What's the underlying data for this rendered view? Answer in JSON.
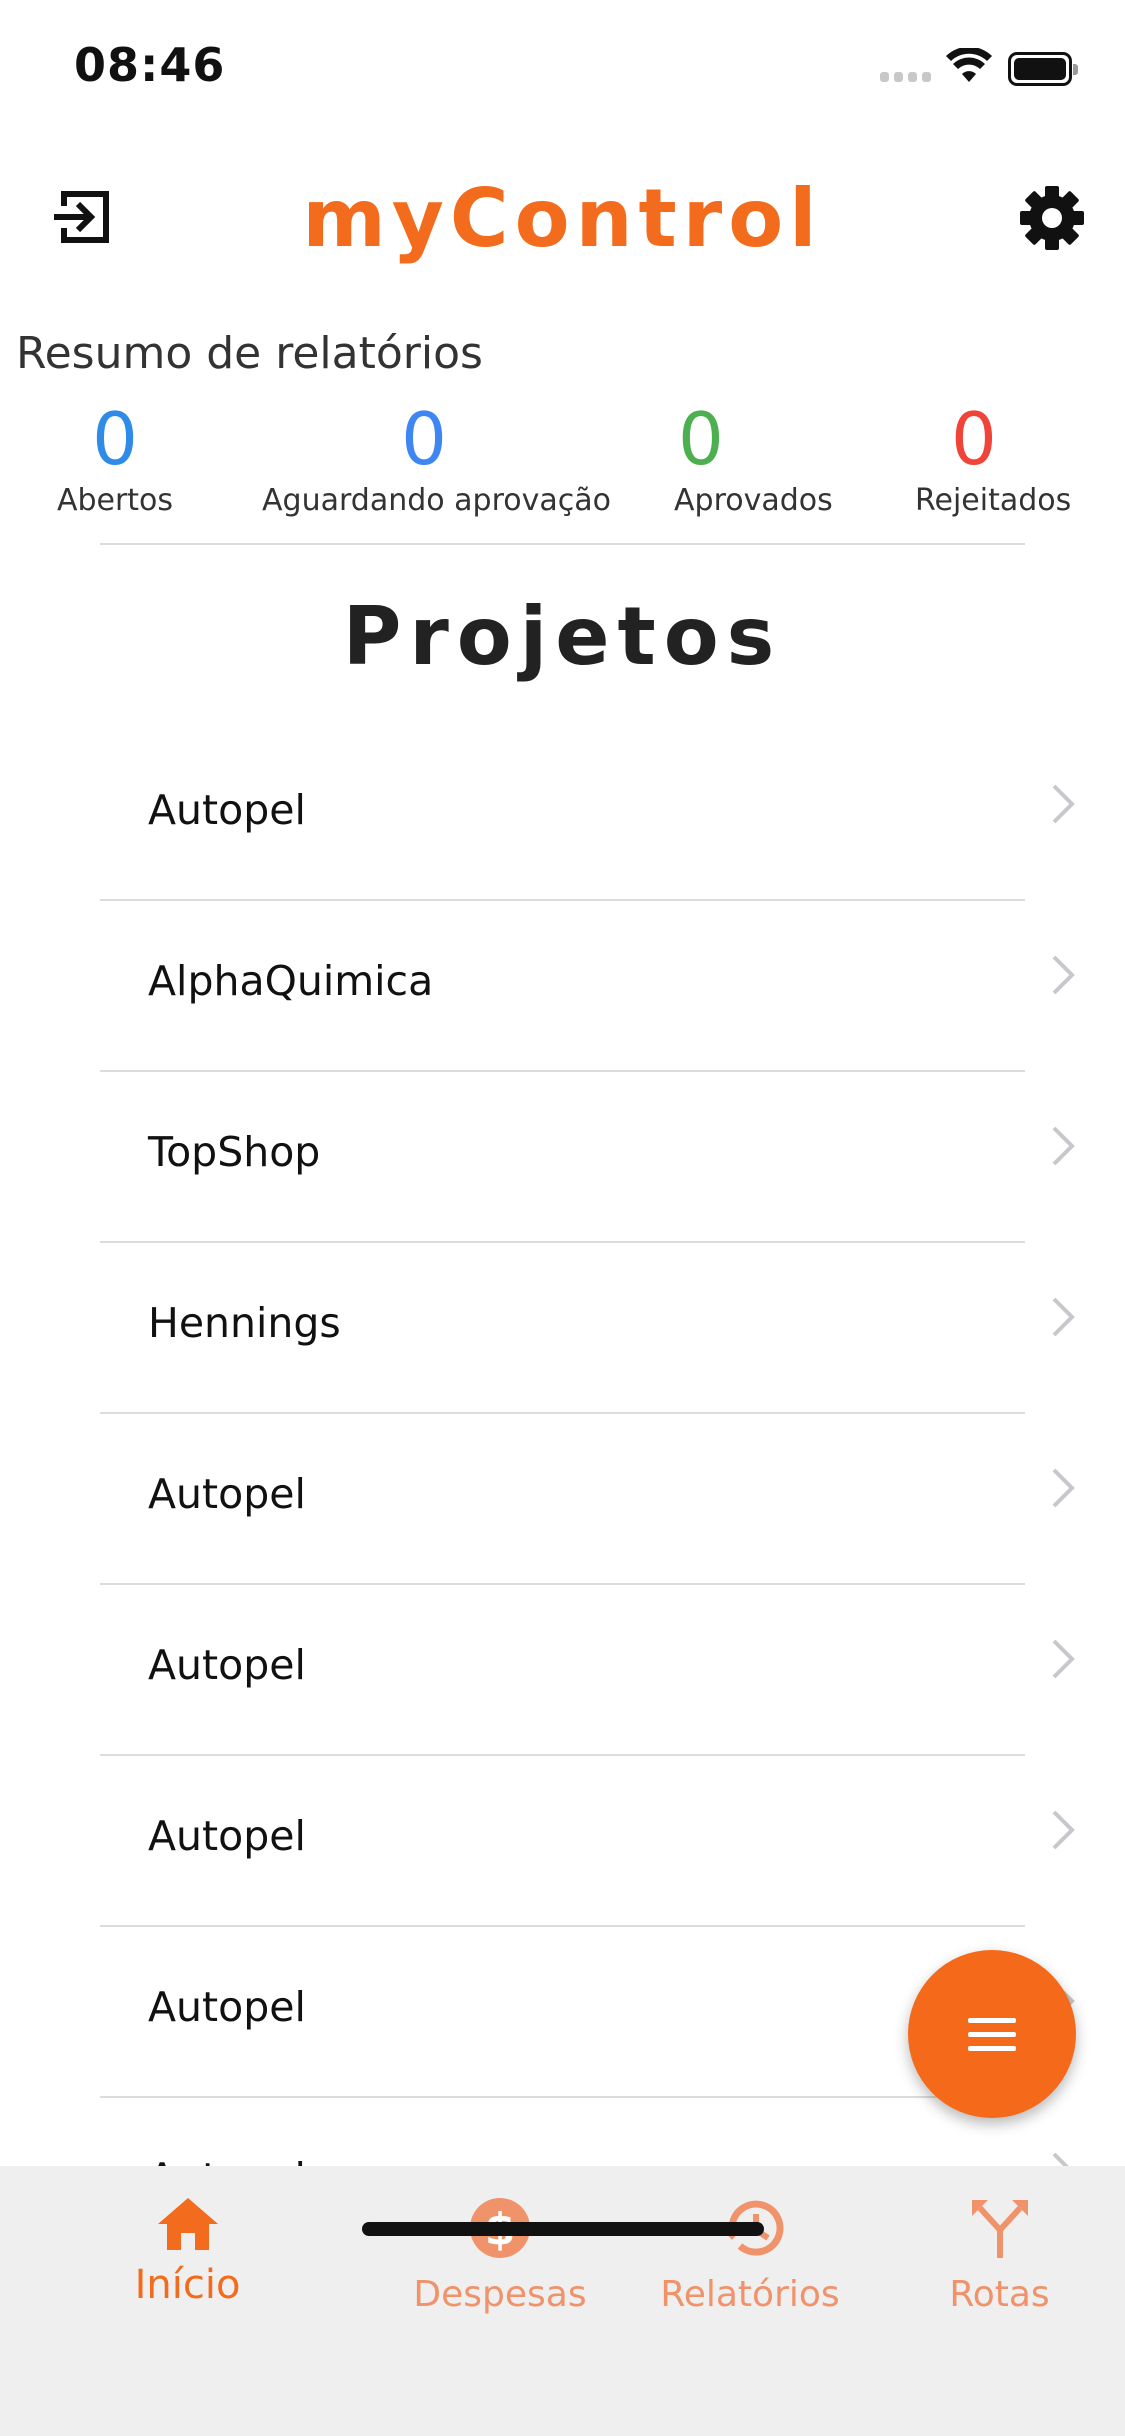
{
  "status_bar": {
    "time": "08:46"
  },
  "header": {
    "title": "myControl"
  },
  "summary": {
    "title": "Resumo de relatórios",
    "stats": [
      {
        "value": "0",
        "label": "Abertos",
        "color": "#2E8BE8"
      },
      {
        "value": "0",
        "label": "Aguardando aprovação",
        "color": "#3E86F2"
      },
      {
        "value": "0",
        "label": "Aprovados",
        "color": "#4CAF50"
      },
      {
        "value": "0",
        "label": "Rejeitados",
        "color": "#F04438"
      }
    ]
  },
  "projects": {
    "title": "Projetos",
    "items": [
      "Autopel",
      "AlphaQuimica",
      "TopShop",
      "Hennings",
      "Autopel",
      "Autopel",
      "Autopel",
      "Autopel",
      "Autopel"
    ]
  },
  "tabs": [
    {
      "label": "Início",
      "icon": "home-icon",
      "active": true
    },
    {
      "label": "Despesas",
      "icon": "dollar-icon",
      "active": false
    },
    {
      "label": "Relatórios",
      "icon": "history-icon",
      "active": false
    },
    {
      "label": "Rotas",
      "icon": "route-split-icon",
      "active": false
    }
  ],
  "colors": {
    "accent": "#F36B1C",
    "tab_inactive": "#F0926A",
    "tab_bar_bg": "#EFEFEF"
  }
}
